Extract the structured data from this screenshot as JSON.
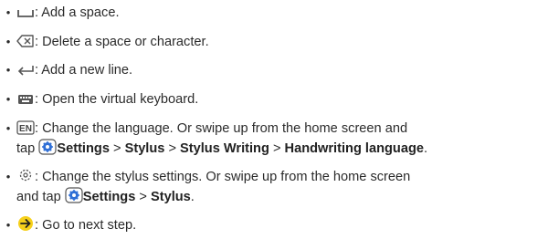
{
  "colors": {
    "text": "#2b2b2b",
    "icon_gray": "#555555",
    "settings_blue": "#2f6fd6",
    "next_yellow": "#f6d01b"
  },
  "items": [
    {
      "icon": "space-icon",
      "text": ": Add a space."
    },
    {
      "icon": "backspace-icon",
      "text": ": Delete a space or character."
    },
    {
      "icon": "new-line-arrow-icon",
      "text": ": Add a new line."
    },
    {
      "icon": "keyboard-icon",
      "text": ": Open the virtual keyboard."
    },
    {
      "icon": "language-en-icon",
      "icon_label": "EN",
      "line1": ": Change the language. Or swipe up from the home screen and",
      "line2_prefix": "tap",
      "settings_icon": "settings-gear-icon",
      "path": [
        "Settings",
        "Stylus",
        "Stylus Writing",
        "Handwriting language"
      ],
      "sep": ">",
      "end": "."
    },
    {
      "icon": "stylus-settings-gear-icon",
      "line1": ": Change the stylus settings. Or swipe up from the home screen",
      "line2_prefix": "and tap",
      "settings_icon": "settings-gear-icon",
      "path": [
        "Settings",
        "Stylus"
      ],
      "sep": ">",
      "end": "."
    },
    {
      "icon": "next-arrow-icon",
      "text": ": Go to next step."
    }
  ],
  "bullet": "•"
}
